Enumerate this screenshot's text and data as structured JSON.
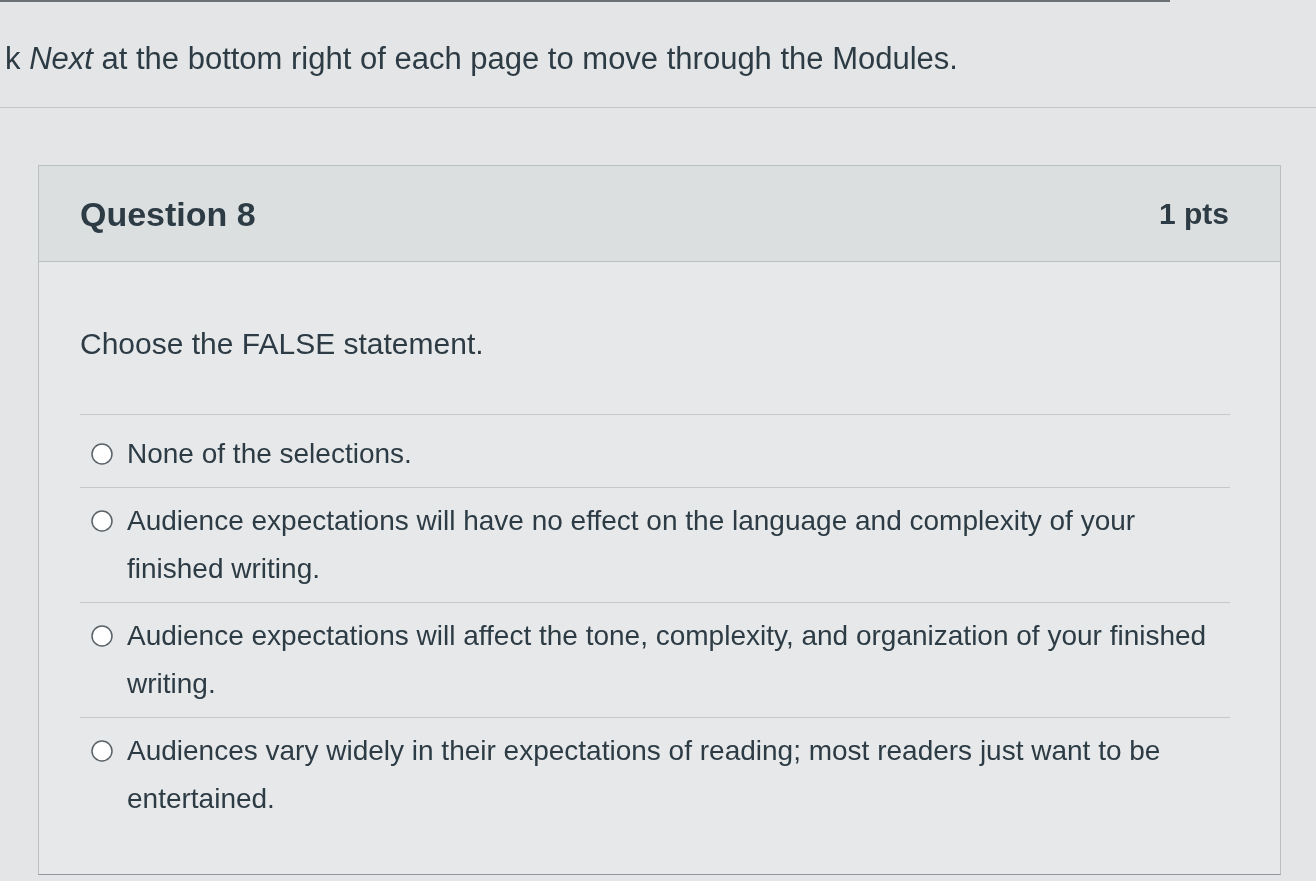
{
  "instruction": "k *Next* at the bottom right of each page to move through the Modules.",
  "question": {
    "title": "Question 8",
    "points": "1 pts",
    "prompt": "Choose the FALSE statement.",
    "answers": [
      {
        "text": "None of the selections.",
        "selected": false
      },
      {
        "text": "Audience expectations will have no effect on the language and complexity of your finished writing.",
        "selected": false
      },
      {
        "text": "Audience expectations will affect the tone, complexity, and organization of your finished writing.",
        "selected": false
      },
      {
        "text": "Audiences vary widely in their expectations of reading; most readers just want to be entertained.",
        "selected": false
      }
    ]
  }
}
